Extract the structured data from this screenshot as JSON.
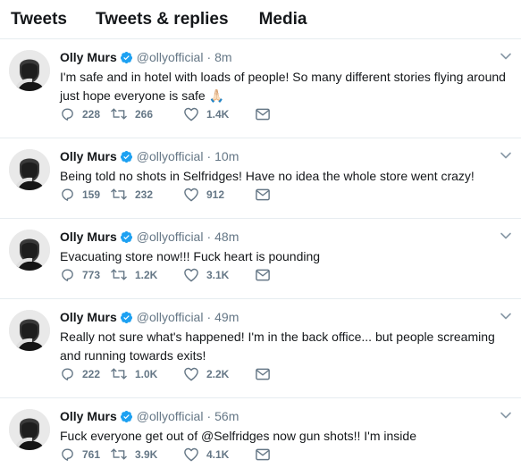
{
  "tabs": [
    "Tweets",
    "Tweets & replies",
    "Media"
  ],
  "tweets": [
    {
      "name": "Olly Murs",
      "handle": "@ollyofficial",
      "time": "8m",
      "text": "I'm safe and in hotel with loads of people! So many different stories flying around just hope everyone is safe 🙏🏻",
      "replies": "228",
      "retweets": "266",
      "likes": "1.4K"
    },
    {
      "name": "Olly Murs",
      "handle": "@ollyofficial",
      "time": "10m",
      "text": "Being told no shots in Selfridges! Have no idea the whole store went crazy!",
      "replies": "159",
      "retweets": "232",
      "likes": "912"
    },
    {
      "name": "Olly Murs",
      "handle": "@ollyofficial",
      "time": "48m",
      "text": "Evacuating store now!!! Fuck heart is pounding",
      "replies": "773",
      "retweets": "1.2K",
      "likes": "3.1K"
    },
    {
      "name": "Olly Murs",
      "handle": "@ollyofficial",
      "time": "49m",
      "text": "Really not sure what's happened! I'm in the back office... but people screaming and running towards exits!",
      "replies": "222",
      "retweets": "1.0K",
      "likes": "2.2K"
    },
    {
      "name": "Olly Murs",
      "handle": "@ollyofficial",
      "time": "56m",
      "text": "Fuck everyone get out of @Selfridges now gun shots!! I'm inside",
      "replies": "761",
      "retweets": "3.9K",
      "likes": "4.1K"
    }
  ],
  "separator": "·",
  "colors": {
    "text": "#14171a",
    "muted": "#657786",
    "verified": "#1da1f2",
    "divider": "#e6ecf0"
  },
  "icons": [
    "verified-badge-icon",
    "chevron-down-icon",
    "reply-icon",
    "retweet-icon",
    "like-icon",
    "message-icon"
  ]
}
